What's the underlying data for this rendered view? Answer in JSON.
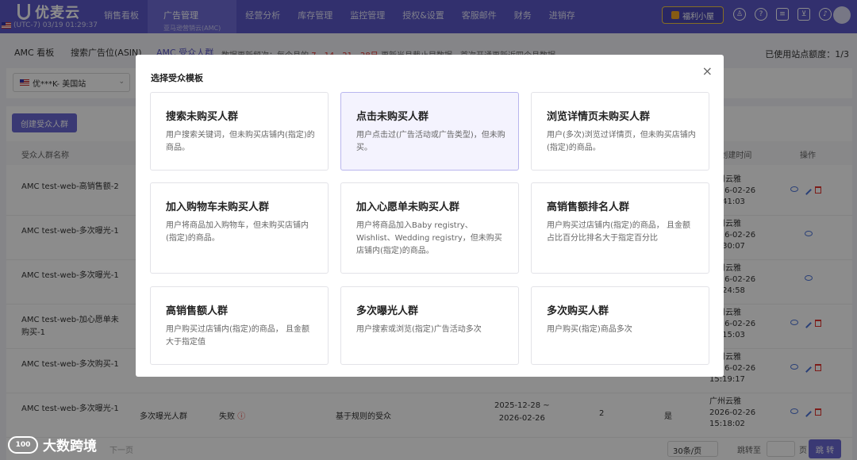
{
  "header": {
    "brand": "优麦云",
    "region": "(UTC-7) 03/19 01:29:37",
    "nav": [
      {
        "label": "销售看板",
        "sub": ""
      },
      {
        "label": "广告管理",
        "sub": "亚马逊营销云(AMC)"
      },
      {
        "label": "经营分析",
        "sub": ""
      },
      {
        "label": "库存管理",
        "sub": ""
      },
      {
        "label": "监控管理",
        "sub": ""
      },
      {
        "label": "授权&设置",
        "sub": ""
      },
      {
        "label": "客服邮件",
        "sub": ""
      },
      {
        "label": "财务",
        "sub": ""
      },
      {
        "label": "进销存",
        "sub": ""
      }
    ],
    "welfare": "福利小屋",
    "icons": [
      "people-icon",
      "help-icon",
      "message-icon",
      "cart-icon",
      "bell-icon"
    ]
  },
  "tabs": [
    {
      "label": "AMC 看板"
    },
    {
      "label": "搜索广告位(ASIN)"
    },
    {
      "label": "AMC 受众人群"
    }
  ],
  "notice": {
    "prefix": "数据更新频次：每个月的",
    "days": [
      "7",
      "14",
      "21",
      "28日"
    ],
    "suffix": "更新当月截止目数据，首次开通更新近四个月数据"
  },
  "quota": "已使用站点额度：1/3",
  "site_select": "优***K- 美国站",
  "create_button": "创建受众人群",
  "table": {
    "headers": {
      "name": "受众人群名称",
      "creator": "人/创建时间",
      "actions": "操作"
    },
    "rows": [
      {
        "name": "AMC test-web-高销售额-2",
        "creator": [
          "广州云雅",
          "2026-02-26",
          "15:41:03"
        ],
        "actions": [
          "eye",
          "edit",
          "delete"
        ]
      },
      {
        "name": "AMC test-web-多次曝光-1",
        "creator": [
          "广州云雅",
          "2026-02-26",
          "15:30:07"
        ],
        "actions": [
          "eye"
        ]
      },
      {
        "name": "AMC test-web-多次曝光-1",
        "creator": [
          "广州云雅",
          "2026-02-26",
          "15:24:58"
        ],
        "actions": [
          "eye"
        ]
      },
      {
        "name": "AMC test-web-加心愿单未购买-1",
        "creator": [
          "广州云雅",
          "2026-02-26",
          "15:15:03"
        ],
        "actions": [
          "eye",
          "edit",
          "delete"
        ]
      },
      {
        "name": "AMC test-web-多次购买-1",
        "creator": [
          "广州云雅",
          "2026-02-26",
          "15:19:17"
        ],
        "actions": [
          "eye",
          "edit",
          "delete"
        ]
      },
      {
        "name": "AMC test-web-多次曝光-1",
        "type": "多次曝光人群",
        "status": "失败",
        "method": "基于规则的受众",
        "period": [
          "2025-12-28 ~",
          "2026-02-26"
        ],
        "count": "2",
        "flag": "是",
        "creator": [
          "广州云雅",
          "2026-02-26",
          "15:18:02"
        ],
        "actions": [
          "eye",
          "edit",
          "delete"
        ]
      }
    ]
  },
  "pager": {
    "prev": "下一页",
    "page_size": "30条/页",
    "goto": "跳转至",
    "page": "页",
    "jump": "跳 转"
  },
  "modal": {
    "title": "选择受众模板",
    "close": "×",
    "templates": [
      {
        "title": "搜索未购买人群",
        "desc": "用户搜索关键词，但未购买店铺内(指定)的商品。"
      },
      {
        "title": "点击未购买人群",
        "desc": "用户点击过(广告活动或广告类型)，但未购买。"
      },
      {
        "title": "浏览详情页未购买人群",
        "desc": "用户(多次)浏览过详情页，但未购买店铺内(指定)的商品。"
      },
      {
        "title": "加入购物车未购买人群",
        "desc": "用户将商品加入购物车，但未购买店铺内(指定)的商品。"
      },
      {
        "title": "加入心愿单未购买人群",
        "desc": "用户将商品加入Baby registry、Wishlist、Wedding registry，但未购买店铺内(指定)的商品。"
      },
      {
        "title": "高销售额排名人群",
        "desc": "用户购买过店铺内(指定)的商品， 且金额占比百分比排名大于指定百分比"
      },
      {
        "title": "高销售额人群",
        "desc": "用户购买过店铺内(指定)的商品， 且金额大于指定值"
      },
      {
        "title": "多次曝光人群",
        "desc": "用户搜索或浏览(指定)广告活动多次"
      },
      {
        "title": "多次购买人群",
        "desc": "用户购买(指定)商品多次"
      }
    ]
  },
  "watermark": "大数跨境"
}
